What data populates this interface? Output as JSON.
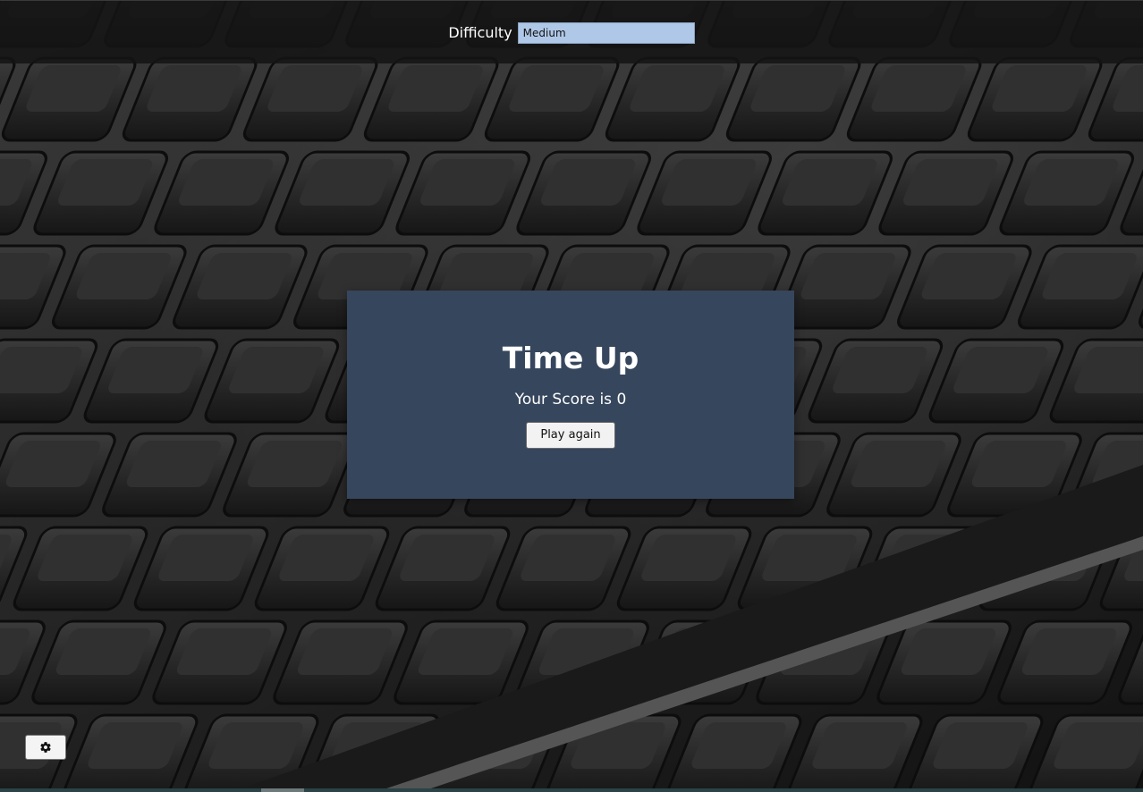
{
  "header": {
    "difficulty_label": "Difficulty",
    "difficulty_selected": "Medium"
  },
  "modal": {
    "title": "Time Up",
    "score_prefix": "Your Score is",
    "score_value": "0",
    "play_again_label": "Play again"
  },
  "settings": {
    "icon": "gear-icon"
  },
  "colors": {
    "topbar_bg": "#141414",
    "select_bg": "#b0c8e8",
    "modal_bg": "#36465d",
    "key_legend_cyan": "#4fb3c4",
    "key_legend_pink": "#c23a78"
  }
}
